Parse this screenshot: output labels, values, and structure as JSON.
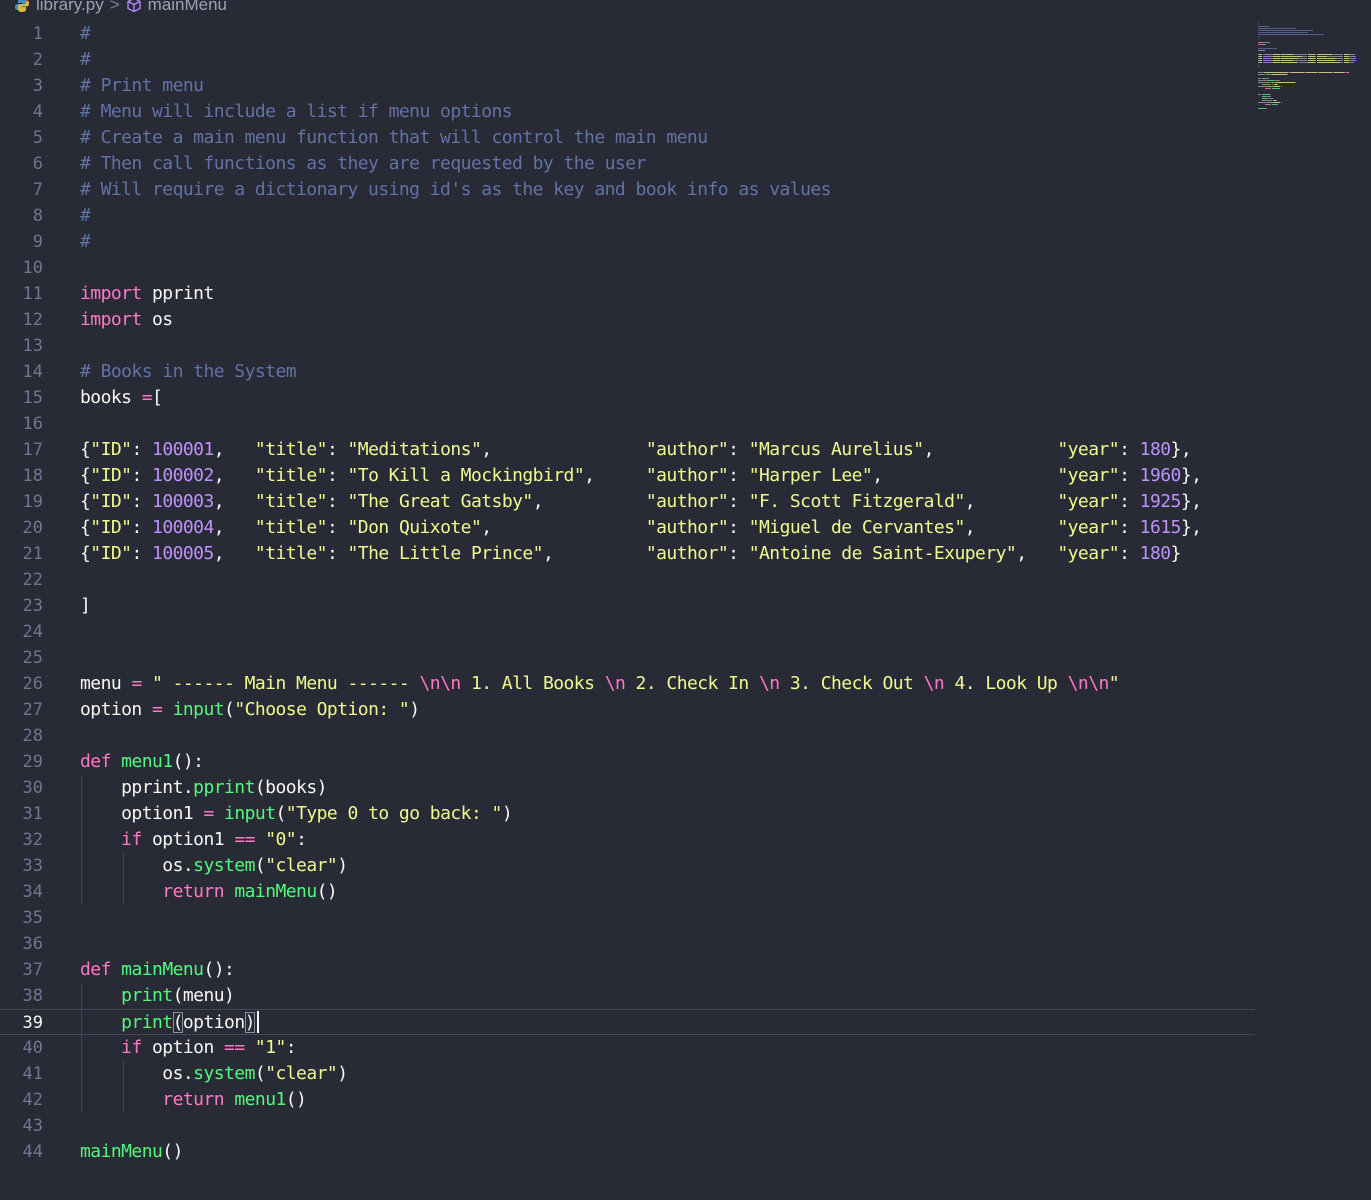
{
  "breadcrumb": {
    "file": "library.py",
    "separator": ">",
    "symbol": "mainMenu"
  },
  "active_line": 39,
  "lines": [
    {
      "n": "1",
      "tokens": [
        [
          "#",
          "c"
        ]
      ]
    },
    {
      "n": "2",
      "tokens": [
        [
          "#",
          "c"
        ]
      ]
    },
    {
      "n": "3",
      "tokens": [
        [
          "# Print menu",
          "c"
        ]
      ]
    },
    {
      "n": "4",
      "tokens": [
        [
          "# Menu will include a list if menu options",
          "c"
        ]
      ]
    },
    {
      "n": "5",
      "tokens": [
        [
          "# Create a main menu function that will control the main menu",
          "c"
        ]
      ]
    },
    {
      "n": "6",
      "tokens": [
        [
          "# Then call functions as they are requested by the user",
          "c"
        ]
      ]
    },
    {
      "n": "7",
      "tokens": [
        [
          "# Will require a dictionary using id's as the key and book info as values",
          "c"
        ]
      ]
    },
    {
      "n": "8",
      "tokens": [
        [
          "#",
          "c"
        ]
      ]
    },
    {
      "n": "9",
      "tokens": [
        [
          "#",
          "c"
        ]
      ]
    },
    {
      "n": "10",
      "tokens": []
    },
    {
      "n": "11",
      "tokens": [
        [
          "import",
          "k"
        ],
        [
          " pprint",
          ""
        ]
      ]
    },
    {
      "n": "12",
      "tokens": [
        [
          "import",
          "k"
        ],
        [
          " os",
          ""
        ]
      ]
    },
    {
      "n": "13",
      "tokens": []
    },
    {
      "n": "14",
      "tokens": [
        [
          "# Books in the System",
          "c"
        ]
      ]
    },
    {
      "n": "15",
      "tokens": [
        [
          "books ",
          ""
        ],
        [
          "=",
          "o"
        ],
        [
          "[",
          ""
        ]
      ]
    },
    {
      "n": "16",
      "tokens": []
    },
    {
      "n": "17",
      "tokens": [
        [
          "{",
          ""
        ],
        [
          "\"ID\"",
          "s"
        ],
        [
          ": ",
          ""
        ],
        [
          "100001",
          "n"
        ],
        [
          ",   ",
          ""
        ],
        [
          "\"title\"",
          "s"
        ],
        [
          ": ",
          ""
        ],
        [
          "\"Meditations\"",
          "s"
        ],
        [
          ",               ",
          ""
        ],
        [
          "\"author\"",
          "s"
        ],
        [
          ": ",
          ""
        ],
        [
          "\"Marcus Aurelius\"",
          "s"
        ],
        [
          ",            ",
          ""
        ],
        [
          "\"year\"",
          "s"
        ],
        [
          ": ",
          ""
        ],
        [
          "180",
          "n"
        ],
        [
          "},",
          ""
        ]
      ]
    },
    {
      "n": "18",
      "tokens": [
        [
          "{",
          ""
        ],
        [
          "\"ID\"",
          "s"
        ],
        [
          ": ",
          ""
        ],
        [
          "100002",
          "n"
        ],
        [
          ",   ",
          ""
        ],
        [
          "\"title\"",
          "s"
        ],
        [
          ": ",
          ""
        ],
        [
          "\"To Kill a Mockingbird\"",
          "s"
        ],
        [
          ",     ",
          ""
        ],
        [
          "\"author\"",
          "s"
        ],
        [
          ": ",
          ""
        ],
        [
          "\"Harper Lee\"",
          "s"
        ],
        [
          ",                 ",
          ""
        ],
        [
          "\"year\"",
          "s"
        ],
        [
          ": ",
          ""
        ],
        [
          "1960",
          "n"
        ],
        [
          "},",
          ""
        ]
      ]
    },
    {
      "n": "19",
      "tokens": [
        [
          "{",
          ""
        ],
        [
          "\"ID\"",
          "s"
        ],
        [
          ": ",
          ""
        ],
        [
          "100003",
          "n"
        ],
        [
          ",   ",
          ""
        ],
        [
          "\"title\"",
          "s"
        ],
        [
          ": ",
          ""
        ],
        [
          "\"The Great Gatsby\"",
          "s"
        ],
        [
          ",          ",
          ""
        ],
        [
          "\"author\"",
          "s"
        ],
        [
          ": ",
          ""
        ],
        [
          "\"F. Scott Fitzgerald\"",
          "s"
        ],
        [
          ",        ",
          ""
        ],
        [
          "\"year\"",
          "s"
        ],
        [
          ": ",
          ""
        ],
        [
          "1925",
          "n"
        ],
        [
          "},",
          ""
        ]
      ]
    },
    {
      "n": "20",
      "tokens": [
        [
          "{",
          ""
        ],
        [
          "\"ID\"",
          "s"
        ],
        [
          ": ",
          ""
        ],
        [
          "100004",
          "n"
        ],
        [
          ",   ",
          ""
        ],
        [
          "\"title\"",
          "s"
        ],
        [
          ": ",
          ""
        ],
        [
          "\"Don Quixote\"",
          "s"
        ],
        [
          ",               ",
          ""
        ],
        [
          "\"author\"",
          "s"
        ],
        [
          ": ",
          ""
        ],
        [
          "\"Miguel de Cervantes\"",
          "s"
        ],
        [
          ",        ",
          ""
        ],
        [
          "\"year\"",
          "s"
        ],
        [
          ": ",
          ""
        ],
        [
          "1615",
          "n"
        ],
        [
          "},",
          ""
        ]
      ]
    },
    {
      "n": "21",
      "tokens": [
        [
          "{",
          ""
        ],
        [
          "\"ID\"",
          "s"
        ],
        [
          ": ",
          ""
        ],
        [
          "100005",
          "n"
        ],
        [
          ",   ",
          ""
        ],
        [
          "\"title\"",
          "s"
        ],
        [
          ": ",
          ""
        ],
        [
          "\"The Little Prince\"",
          "s"
        ],
        [
          ",         ",
          ""
        ],
        [
          "\"author\"",
          "s"
        ],
        [
          ": ",
          ""
        ],
        [
          "\"Antoine de Saint-Exupery\"",
          "s"
        ],
        [
          ",   ",
          ""
        ],
        [
          "\"year\"",
          "s"
        ],
        [
          ": ",
          ""
        ],
        [
          "180",
          "n"
        ],
        [
          "}",
          ""
        ]
      ]
    },
    {
      "n": "22",
      "tokens": []
    },
    {
      "n": "23",
      "tokens": [
        [
          "]",
          ""
        ]
      ]
    },
    {
      "n": "24",
      "tokens": []
    },
    {
      "n": "25",
      "tokens": []
    },
    {
      "n": "26",
      "tokens": [
        [
          "menu ",
          ""
        ],
        [
          "=",
          "o"
        ],
        [
          " ",
          ""
        ],
        [
          "\" ------ Main Menu ------ ",
          "s"
        ],
        [
          "\\n\\n",
          "k"
        ],
        [
          " 1. All Books ",
          "s"
        ],
        [
          "\\n",
          "k"
        ],
        [
          " 2. Check In ",
          "s"
        ],
        [
          "\\n",
          "k"
        ],
        [
          " 3. Check Out ",
          "s"
        ],
        [
          "\\n",
          "k"
        ],
        [
          " 4. Look Up ",
          "s"
        ],
        [
          "\\n\\n",
          "k"
        ],
        [
          "\"",
          "s"
        ]
      ]
    },
    {
      "n": "27",
      "tokens": [
        [
          "option ",
          ""
        ],
        [
          "=",
          "o"
        ],
        [
          " ",
          ""
        ],
        [
          "input",
          "f"
        ],
        [
          "(",
          ""
        ],
        [
          "\"Choose Option: \"",
          "s"
        ],
        [
          ")",
          ""
        ]
      ]
    },
    {
      "n": "28",
      "tokens": []
    },
    {
      "n": "29",
      "tokens": [
        [
          "def",
          "k"
        ],
        [
          " ",
          ""
        ],
        [
          "menu1",
          "f"
        ],
        [
          "():",
          ""
        ]
      ]
    },
    {
      "n": "30",
      "tokens": [
        [
          "    pprint.",
          ""
        ],
        [
          "pprint",
          "f"
        ],
        [
          "(books)",
          ""
        ]
      ]
    },
    {
      "n": "31",
      "tokens": [
        [
          "    option1 ",
          ""
        ],
        [
          "=",
          "o"
        ],
        [
          " ",
          ""
        ],
        [
          "input",
          "f"
        ],
        [
          "(",
          ""
        ],
        [
          "\"Type 0 to go back: \"",
          "s"
        ],
        [
          ")",
          ""
        ]
      ]
    },
    {
      "n": "32",
      "tokens": [
        [
          "    ",
          ""
        ],
        [
          "if",
          "k"
        ],
        [
          " option1 ",
          ""
        ],
        [
          "==",
          "o"
        ],
        [
          " ",
          ""
        ],
        [
          "\"0\"",
          "s"
        ],
        [
          ":",
          ""
        ]
      ]
    },
    {
      "n": "33",
      "tokens": [
        [
          "        os.",
          ""
        ],
        [
          "system",
          "f"
        ],
        [
          "(",
          ""
        ],
        [
          "\"clear\"",
          "s"
        ],
        [
          ")",
          ""
        ]
      ]
    },
    {
      "n": "34",
      "tokens": [
        [
          "        ",
          ""
        ],
        [
          "return",
          "k"
        ],
        [
          " ",
          ""
        ],
        [
          "mainMenu",
          "f"
        ],
        [
          "()",
          ""
        ]
      ]
    },
    {
      "n": "35",
      "tokens": []
    },
    {
      "n": "36",
      "tokens": []
    },
    {
      "n": "37",
      "tokens": [
        [
          "def",
          "k"
        ],
        [
          " ",
          ""
        ],
        [
          "mainMenu",
          "f"
        ],
        [
          "():",
          ""
        ]
      ]
    },
    {
      "n": "38",
      "tokens": [
        [
          "    ",
          ""
        ],
        [
          "print",
          "f"
        ],
        [
          "(menu)",
          ""
        ]
      ]
    },
    {
      "n": "39",
      "tokens": [
        [
          "    ",
          ""
        ],
        [
          "print",
          "f"
        ],
        [
          "(",
          "bm"
        ],
        [
          "option",
          ""
        ],
        [
          ")",
          "bm"
        ]
      ]
    },
    {
      "n": "40",
      "tokens": [
        [
          "    ",
          ""
        ],
        [
          "if",
          "k"
        ],
        [
          " option ",
          ""
        ],
        [
          "==",
          "o"
        ],
        [
          " ",
          ""
        ],
        [
          "\"1\"",
          "s"
        ],
        [
          ":",
          ""
        ]
      ]
    },
    {
      "n": "41",
      "tokens": [
        [
          "        os.",
          ""
        ],
        [
          "system",
          "f"
        ],
        [
          "(",
          ""
        ],
        [
          "\"clear\"",
          "s"
        ],
        [
          ")",
          ""
        ]
      ]
    },
    {
      "n": "42",
      "tokens": [
        [
          "        ",
          ""
        ],
        [
          "return",
          "k"
        ],
        [
          " ",
          ""
        ],
        [
          "menu1",
          "f"
        ],
        [
          "()",
          ""
        ]
      ]
    },
    {
      "n": "43",
      "tokens": []
    },
    {
      "n": "44",
      "tokens": [
        [
          "mainMenu",
          "f"
        ],
        [
          "()",
          ""
        ]
      ]
    }
  ]
}
